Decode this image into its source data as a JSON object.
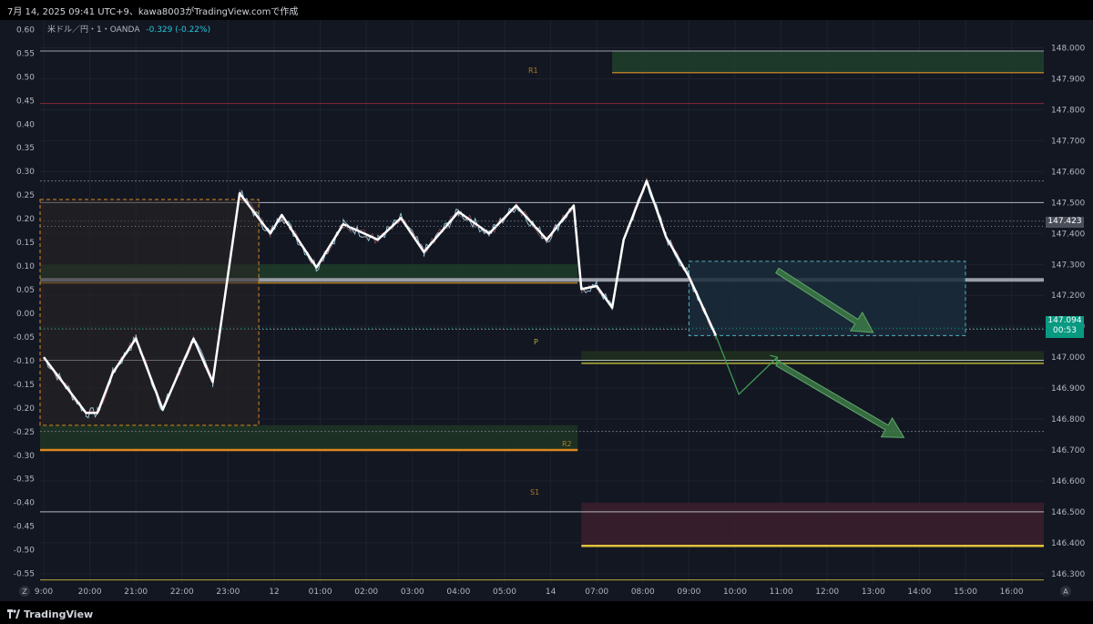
{
  "header": {
    "caption": "7月 14, 2025 09:41 UTC+9、kawa8003がTradingView.comで作成"
  },
  "legend": {
    "symbol": "米ドル／円・1・OANDA",
    "change": "-0.329 (-0.22%)"
  },
  "footer": {
    "brand": "TradingView",
    "left_button": "Z",
    "right_button": "A"
  },
  "price_tags": {
    "current_price": "147.423",
    "last_price": "147.094",
    "countdown": "00:53"
  },
  "zone_labels": {
    "r1": "R1",
    "p": "P",
    "r2": "R2",
    "s1": "S1"
  },
  "colors": {
    "background": "#131722",
    "grid": "#1e222d",
    "price_line": "#ffffff",
    "zigzag": "#ffffff",
    "support_zone": "#1e3a2a",
    "resistance_zone": "#3a1e2a",
    "forecast_box": "#1b2b3a",
    "arrow": "#3e7a45"
  },
  "chart_data": {
    "type": "line",
    "title": "",
    "xlabel": "",
    "ylabel": "",
    "x_ticks": [
      "9:00",
      "20:00",
      "21:00",
      "22:00",
      "23:00",
      "12",
      "01:00",
      "02:00",
      "03:00",
      "04:00",
      "05:00",
      "14",
      "07:00",
      "08:00",
      "09:00",
      "10:00",
      "11:00",
      "12:00",
      "13:00",
      "14:00",
      "15:00",
      "16:00"
    ],
    "right_ticks": [
      "148.000",
      "147.900",
      "147.800",
      "147.700",
      "147.600",
      "147.500",
      "147.400",
      "147.300",
      "147.200",
      "147.100",
      "147.000",
      "146.900",
      "146.800",
      "146.700",
      "146.600",
      "146.500",
      "146.400",
      "146.300"
    ],
    "left_ticks": [
      "0.60",
      "0.55",
      "0.50",
      "0.45",
      "0.40",
      "0.35",
      "0.30",
      "0.25",
      "0.20",
      "0.15",
      "0.10",
      "0.05",
      "0.00",
      "-0.05",
      "-0.10",
      "-0.15",
      "-0.20",
      "-0.25",
      "-0.30",
      "-0.35",
      "-0.40",
      "-0.45",
      "-0.50",
      "-0.55"
    ],
    "ylim_right": [
      146.27,
      148.09
    ],
    "ylim_left": [
      -0.57,
      0.62
    ],
    "grid": true,
    "zigzag_points": [
      {
        "t": "19:00",
        "y": 147.0
      },
      {
        "t": "19:55",
        "y": 146.82
      },
      {
        "t": "20:10",
        "y": 146.82
      },
      {
        "t": "20:30",
        "y": 146.95
      },
      {
        "t": "21:00",
        "y": 147.06
      },
      {
        "t": "21:35",
        "y": 146.83
      },
      {
        "t": "22:15",
        "y": 147.06
      },
      {
        "t": "22:40",
        "y": 146.92
      },
      {
        "t": "23:15",
        "y": 147.53
      },
      {
        "t": "23:55",
        "y": 147.4
      },
      {
        "t": "00:10",
        "y": 147.46
      },
      {
        "t": "00:55",
        "y": 147.29
      },
      {
        "t": "01:30",
        "y": 147.43
      },
      {
        "t": "02:15",
        "y": 147.38
      },
      {
        "t": "02:45",
        "y": 147.45
      },
      {
        "t": "03:15",
        "y": 147.34
      },
      {
        "t": "04:00",
        "y": 147.47
      },
      {
        "t": "04:40",
        "y": 147.4
      },
      {
        "t": "05:15",
        "y": 147.49
      },
      {
        "t": "05:55",
        "y": 147.38
      },
      {
        "t": "06:30",
        "y": 147.49
      },
      {
        "t": "06:40",
        "y": 147.22
      },
      {
        "t": "07:00",
        "y": 147.23
      },
      {
        "t": "07:20",
        "y": 147.16
      },
      {
        "t": "07:35",
        "y": 147.38
      },
      {
        "t": "08:05",
        "y": 147.57
      },
      {
        "t": "08:30",
        "y": 147.39
      },
      {
        "t": "09:00",
        "y": 147.26
      },
      {
        "t": "09:35",
        "y": 147.07
      }
    ],
    "forecast_path": [
      {
        "t": "09:35",
        "y": 147.07
      },
      {
        "t": "10:05",
        "y": 146.88
      },
      {
        "t": "10:55",
        "y": 147.0
      }
    ],
    "horizontal_levels": [
      147.99,
      147.82,
      147.57,
      147.5,
      147.44,
      147.09,
      146.99,
      146.76,
      146.5,
      146.28
    ],
    "zones": [
      {
        "name": "R1",
        "from": 147.92,
        "to": 147.99
      },
      {
        "name": "upper-green",
        "from": 147.24,
        "to": 147.3
      },
      {
        "name": "P",
        "from": 146.98,
        "to": 147.02
      },
      {
        "name": "R2",
        "from": 146.7,
        "to": 146.78
      },
      {
        "name": "S1",
        "from": 146.39,
        "to": 146.53
      }
    ]
  }
}
